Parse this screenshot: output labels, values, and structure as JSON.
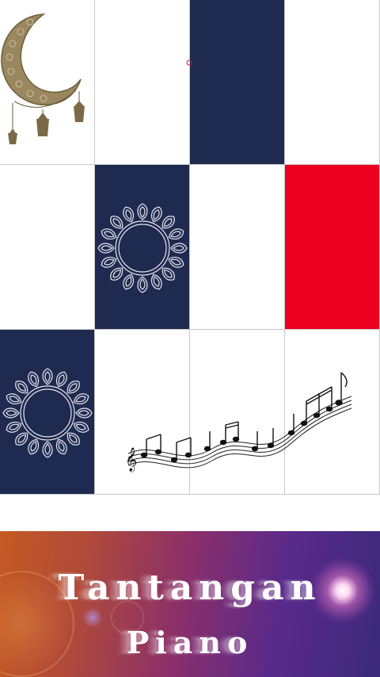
{
  "game": {
    "title_line1": "Tantangan",
    "title_line2": "Piano"
  },
  "tiles": [
    {
      "row": 0,
      "col": 0,
      "color": "white",
      "decoration": "crescent-moon-lantern-icon"
    },
    {
      "row": 0,
      "col": 1,
      "color": "white",
      "decoration": ""
    },
    {
      "row": 0,
      "col": 2,
      "color": "navy",
      "decoration": ""
    },
    {
      "row": 0,
      "col": 3,
      "color": "white",
      "decoration": ""
    },
    {
      "row": 1,
      "col": 0,
      "color": "white",
      "decoration": ""
    },
    {
      "row": 1,
      "col": 1,
      "color": "navy",
      "decoration": "mandala-icon"
    },
    {
      "row": 1,
      "col": 2,
      "color": "white",
      "decoration": ""
    },
    {
      "row": 1,
      "col": 3,
      "color": "red",
      "decoration": ""
    },
    {
      "row": 2,
      "col": 0,
      "color": "navy",
      "decoration": "mandala-icon"
    },
    {
      "row": 2,
      "col": 1,
      "color": "white",
      "decoration": ""
    },
    {
      "row": 2,
      "col": 2,
      "color": "white",
      "decoration": ""
    },
    {
      "row": 2,
      "col": 3,
      "color": "white",
      "decoration": ""
    }
  ],
  "colors": {
    "navy": "#1f2a50",
    "red": "#ec0020",
    "white": "#ffffff",
    "moon_gold": "#8b7a55"
  },
  "decorations": {
    "music_staff": "music-notes-staff-icon"
  }
}
